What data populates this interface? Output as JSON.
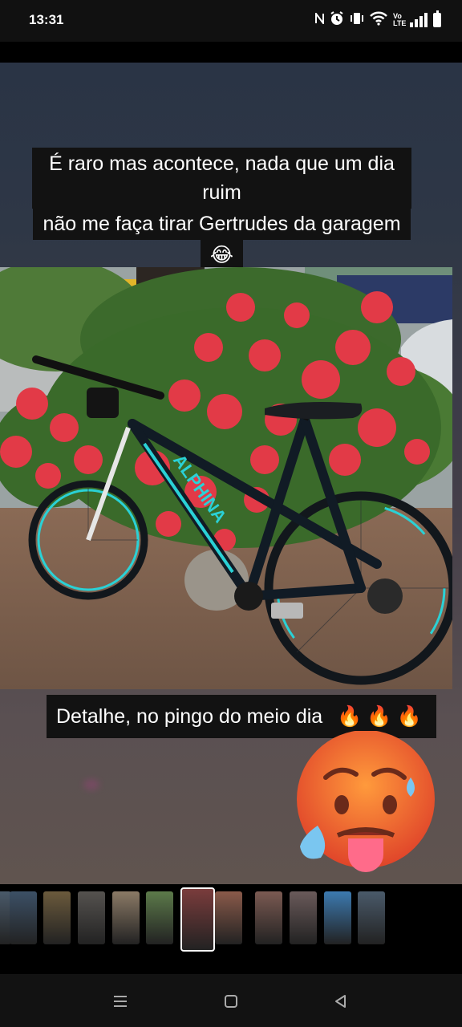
{
  "status": {
    "time": "13:31",
    "icons": [
      "nfc-icon",
      "alarm-icon",
      "vibrate-icon",
      "wifi-icon",
      "volte-icon",
      "signal-icon",
      "battery-icon"
    ],
    "volte_text": "Vo\nLTE"
  },
  "story": {
    "caption_top": [
      "É raro mas acontece, nada que um dia ruim",
      "não me faça tirar Gertrudes da garagem",
      "😂"
    ],
    "caption_bottom": "Detalhe, no pingo do meio dia",
    "caption_bottom_emojis": "🔥🔥🔥",
    "photo_brand_text": "ALPHINA",
    "sticker": "hot-face-emoji"
  },
  "thumbnails": {
    "count": 12,
    "active_index": 6,
    "colors": [
      "#4a5a6a",
      "#3c5066",
      "#6b5a3c",
      "#55524f",
      "#8b7a66",
      "#5c7a4a",
      "#7a3c3c",
      "#8a5a4a",
      "#7b5a52",
      "#6a5a5a",
      "#3c7ab0",
      "#4a5a6a"
    ]
  },
  "nav": {
    "recents": "≡",
    "home": "▢",
    "back": "◁"
  },
  "colors": {
    "caption_bg": "#121212",
    "bike_frame": "#111b25",
    "bike_accent": "#2ad1d6",
    "flower_red": "#e23a47"
  }
}
